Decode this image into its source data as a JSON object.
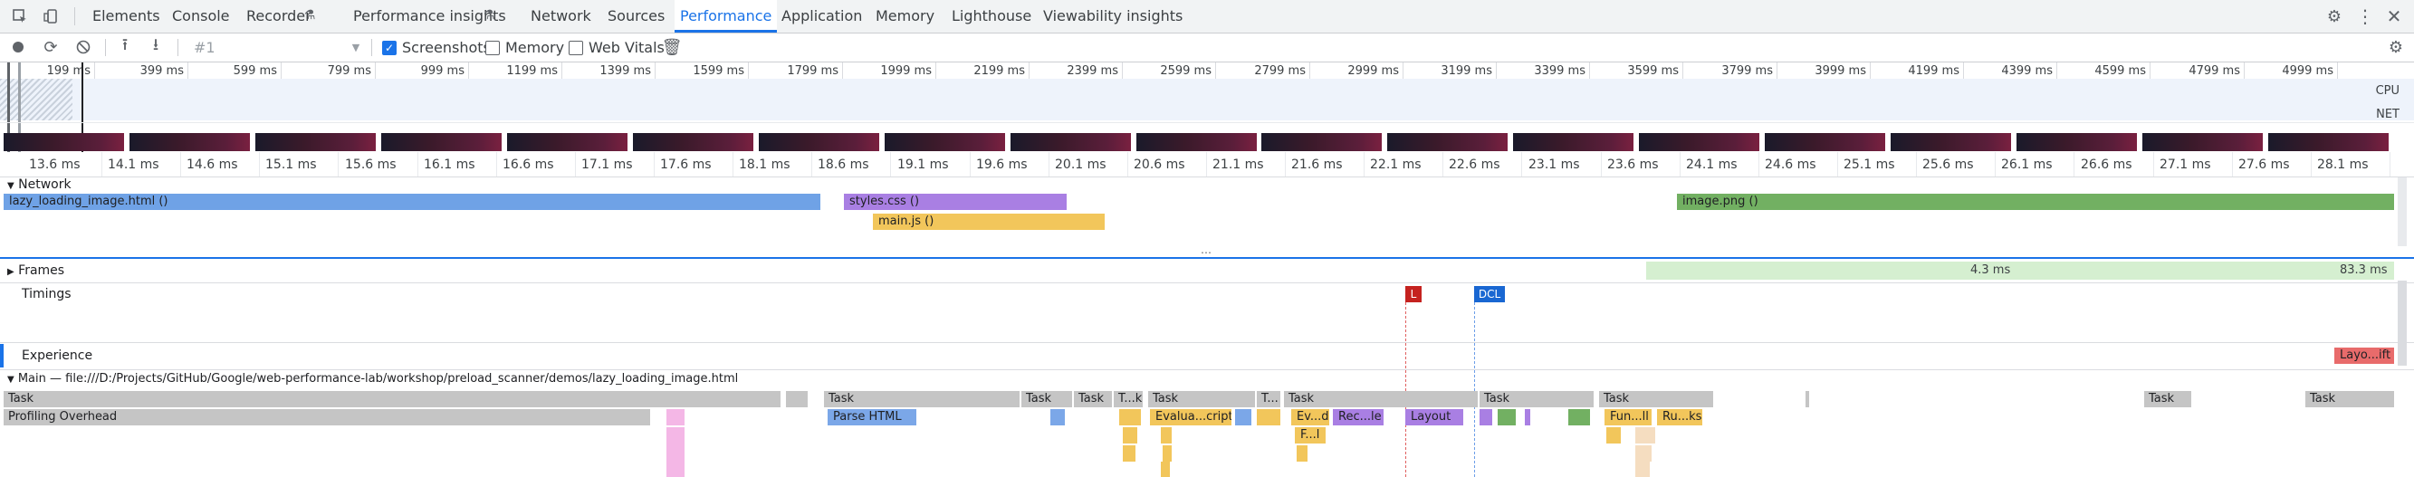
{
  "tabs": [
    "Elements",
    "Console",
    "Recorder",
    "Performance insights",
    "Network",
    "Sources",
    "Performance",
    "Application",
    "Memory",
    "Lighthouse",
    "Viewability insights"
  ],
  "active_tab": "Performance",
  "toolbar": {
    "recording": "#1",
    "screenshots_label": "Screenshots",
    "memory_label": "Memory",
    "webvitals_label": "Web Vitals"
  },
  "overview": {
    "ticks": [
      "199 ms",
      "399 ms",
      "599 ms",
      "799 ms",
      "999 ms",
      "1199 ms",
      "1399 ms",
      "1599 ms",
      "1799 ms",
      "1999 ms",
      "2199 ms",
      "2399 ms",
      "2599 ms",
      "2799 ms",
      "2999 ms",
      "3199 ms",
      "3399 ms",
      "3599 ms",
      "3799 ms",
      "3999 ms",
      "4199 ms",
      "4399 ms",
      "4599 ms",
      "4799 ms",
      "4999 ms"
    ],
    "cpu_label": "CPU",
    "net_label": "NET"
  },
  "ruler": [
    "13.6 ms",
    "14.1 ms",
    "14.6 ms",
    "15.1 ms",
    "15.6 ms",
    "16.1 ms",
    "16.6 ms",
    "17.1 ms",
    "17.6 ms",
    "18.1 ms",
    "18.6 ms",
    "19.1 ms",
    "19.6 ms",
    "20.1 ms",
    "20.6 ms",
    "21.1 ms",
    "21.6 ms",
    "22.1 ms",
    "22.6 ms",
    "23.1 ms",
    "23.6 ms",
    "24.1 ms",
    "24.6 ms",
    "25.1 ms",
    "25.6 ms",
    "26.1 ms",
    "26.6 ms",
    "27.1 ms",
    "27.6 ms",
    "28.1 ms"
  ],
  "network": {
    "title": "Network",
    "requests": [
      {
        "label": "lazy_loading_image.html ()",
        "color": "#6fa2e6"
      },
      {
        "label": "styles.css ()",
        "color": "#a97fe3"
      },
      {
        "label": "main.js ()",
        "color": "#f2c65b"
      },
      {
        "label": "image.png ()",
        "color": "#72b062"
      }
    ]
  },
  "frames": {
    "title": "Frames",
    "value1": "4.3 ms",
    "value2": "83.3 ms"
  },
  "timings": {
    "title": "Timings",
    "markers": [
      "L",
      "DCL"
    ]
  },
  "experience": {
    "title": "Experience",
    "event": "Layo...ift"
  },
  "main": {
    "title": "Main — file:///D:/Projects/GitHub/Google/web-performance-lab/workshop/preload_scanner/demos/lazy_loading_image.html",
    "tasks": [
      "Task",
      "Task",
      "Task",
      "Task",
      "T...k",
      "Task",
      "T...",
      "Task",
      "Task",
      "Task",
      "Task",
      "Task"
    ],
    "row2": [
      "Profiling Overhead",
      "Parse HTML",
      "Evalua...cript",
      "Ev...d",
      "Rec...le",
      "Layout",
      "Fun...ll",
      "Ru...ks"
    ],
    "row3": [
      "F...l"
    ]
  },
  "colors": {
    "accent": "#1a73e8",
    "marker_l": "#c5221f",
    "marker_dcl": "#1967d2",
    "frames_green": "#d5efd0",
    "layout_shift": "#e86b6b"
  }
}
